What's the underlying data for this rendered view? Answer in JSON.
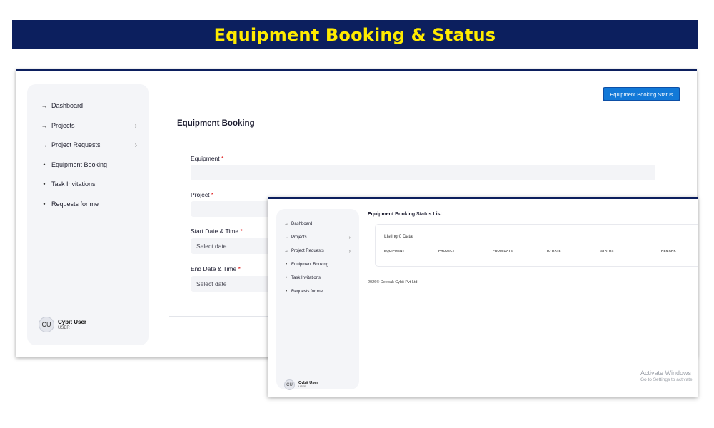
{
  "banner": {
    "title": "Equipment Booking & Status"
  },
  "back_window": {
    "sidebar": {
      "items": [
        {
          "label": "Dashboard",
          "bullet": "→",
          "has_chevron": false
        },
        {
          "label": "Projects",
          "bullet": "→",
          "has_chevron": true
        },
        {
          "label": "Project Requests",
          "bullet": "→",
          "has_chevron": true
        },
        {
          "label": "Equipment Booking",
          "bullet": "•",
          "has_chevron": false
        },
        {
          "label": "Task Invitations",
          "bullet": "•",
          "has_chevron": false
        },
        {
          "label": "Requests for me",
          "bullet": "•",
          "has_chevron": false
        }
      ],
      "chevron": "›",
      "user": {
        "initials": "CU",
        "name": "Cybit User",
        "role": "USER"
      }
    },
    "status_button": "Equipment Booking Status",
    "page_title": "Equipment Booking",
    "fields": {
      "equipment": {
        "label": "Equipment",
        "value": ""
      },
      "project": {
        "label": "Project",
        "value": ""
      },
      "start": {
        "label": "Start Date & Time",
        "placeholder": "Select date"
      },
      "end": {
        "label": "End Date & Time",
        "placeholder": "Select date"
      },
      "required_mark": "*"
    }
  },
  "front_window": {
    "sidebar": {
      "items": [
        {
          "label": "Dashboard",
          "bullet": "→"
        },
        {
          "label": "Projects",
          "bullet": "→"
        },
        {
          "label": "Project Requests",
          "bullet": "→"
        },
        {
          "label": "Equipment Booking",
          "bullet": "•"
        },
        {
          "label": "Task Invitations",
          "bullet": "•"
        },
        {
          "label": "Requests for me",
          "bullet": "•"
        }
      ],
      "chevron": "›",
      "user": {
        "initials": "CU",
        "name": "Cybit User",
        "role": "USER"
      }
    },
    "list_title": "Equipment Booking Status List",
    "listing": "Listing 0 Data",
    "columns": [
      "EQUIPMENT",
      "PROJECT",
      "FROM DATE",
      "TO DATE",
      "STATUS",
      "REMARK"
    ],
    "copyright": "2026© Deepak Cybit Pvt Ltd"
  },
  "watermark": {
    "line1": "Activate Windows",
    "line2": "Go to Settings to activate"
  },
  "colors": {
    "banner_bg": "#0c1f5e",
    "banner_text": "#ffeb00",
    "button": "#1279d8",
    "required": "#dd1111"
  }
}
